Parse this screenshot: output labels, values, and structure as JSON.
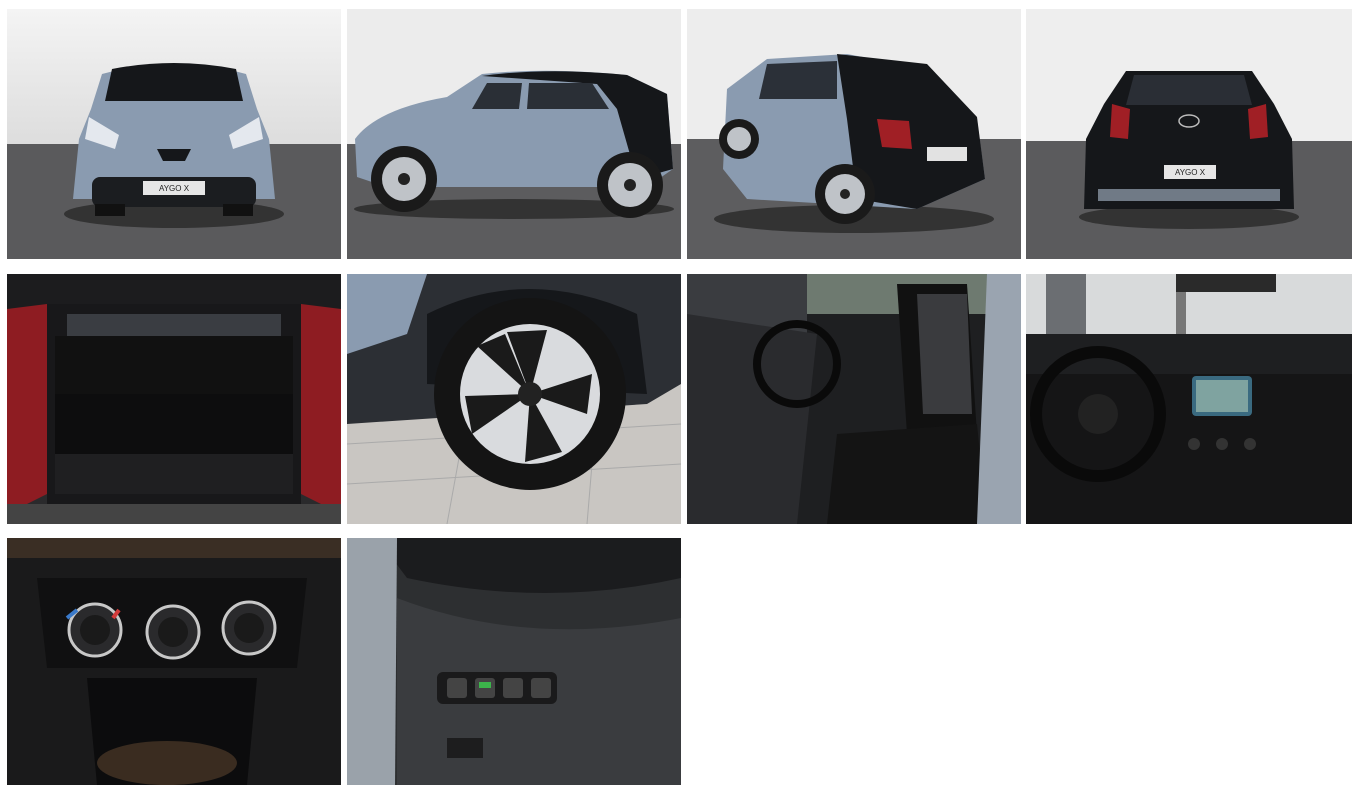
{
  "gallery": {
    "photos": [
      {
        "id": "front",
        "plate": "AYGO X",
        "icon": "car-front"
      },
      {
        "id": "side",
        "icon": "car-side"
      },
      {
        "id": "rear-three-quarter",
        "icon": "car-rear-quarter"
      },
      {
        "id": "rear",
        "plate": "AYGO X",
        "icon": "car-rear"
      },
      {
        "id": "trunk",
        "icon": "trunk"
      },
      {
        "id": "wheel",
        "icon": "wheel"
      },
      {
        "id": "front-seats",
        "icon": "seat"
      },
      {
        "id": "dashboard",
        "icon": "steering-wheel"
      },
      {
        "id": "climate-controls",
        "icon": "climate-knobs"
      },
      {
        "id": "switch-panel",
        "icon": "switches"
      }
    ]
  },
  "colors": {
    "background": "#ffffff",
    "body_grey_blue": "#8a9bb0",
    "roof_black": "#15171a",
    "floor_grey": "#5a5a5c"
  }
}
